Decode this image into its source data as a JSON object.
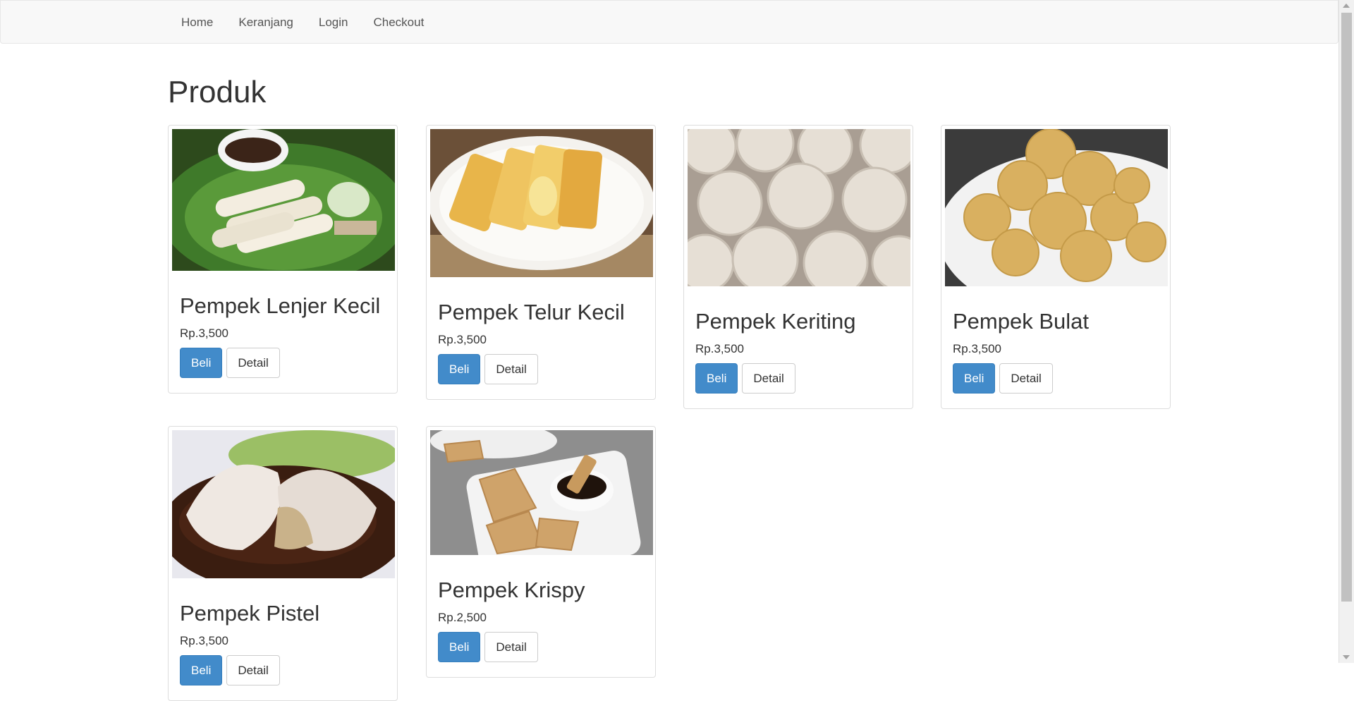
{
  "nav": {
    "items": [
      "Home",
      "Keranjang",
      "Login",
      "Checkout"
    ]
  },
  "page": {
    "title": "Produk"
  },
  "buttons": {
    "buy": "Beli",
    "detail": "Detail"
  },
  "products": [
    {
      "name": "Pempek Lenjer Kecil",
      "price": "Rp.3,500",
      "image": "pempek-lenjer-image"
    },
    {
      "name": "Pempek Telur Kecil",
      "price": "Rp.3,500",
      "image": "pempek-telur-image"
    },
    {
      "name": "Pempek Keriting",
      "price": "Rp.3,500",
      "image": "pempek-keriting-image"
    },
    {
      "name": "Pempek Bulat",
      "price": "Rp.3,500",
      "image": "pempek-bulat-image"
    },
    {
      "name": "Pempek Pistel",
      "price": "Rp.3,500",
      "image": "pempek-pistel-image"
    },
    {
      "name": "Pempek Krispy",
      "price": "Rp.2,500",
      "image": "pempek-krispy-image"
    }
  ],
  "colors": {
    "primary": "#428bca",
    "navbar_bg": "#f8f8f8"
  }
}
